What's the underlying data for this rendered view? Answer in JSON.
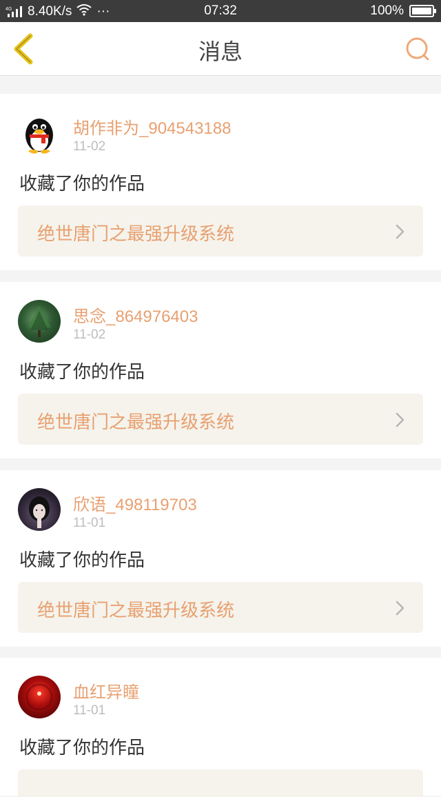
{
  "status_bar": {
    "network_type": "4G",
    "speed": "8.40K/s",
    "more": "···",
    "time": "07:32",
    "battery": "100%"
  },
  "header": {
    "title": "消息",
    "back_icon": "chevron-left-icon",
    "search_icon": "search-icon"
  },
  "colors": {
    "accent": "#e8a070",
    "back_icon": "#e6c21a",
    "work_bg": "#f5f3ec"
  },
  "messages": [
    {
      "username": "胡作非为_904543188",
      "date": "11-02",
      "action": "收藏了你的作品",
      "work_title": "绝世唐门之最强升级系统",
      "avatar": "penguin-avatar"
    },
    {
      "username": "思念_864976403",
      "date": "11-02",
      "action": "收藏了你的作品",
      "work_title": "绝世唐门之最强升级系统",
      "avatar": "tree-avatar"
    },
    {
      "username": "欣语_498119703",
      "date": "11-01",
      "action": "收藏了你的作品",
      "work_title": "绝世唐门之最强升级系统",
      "avatar": "person-avatar"
    },
    {
      "username": "血红异瞳",
      "date": "11-01",
      "action": "收藏了你的作品",
      "work_title": "",
      "avatar": "red-eye-avatar"
    }
  ]
}
